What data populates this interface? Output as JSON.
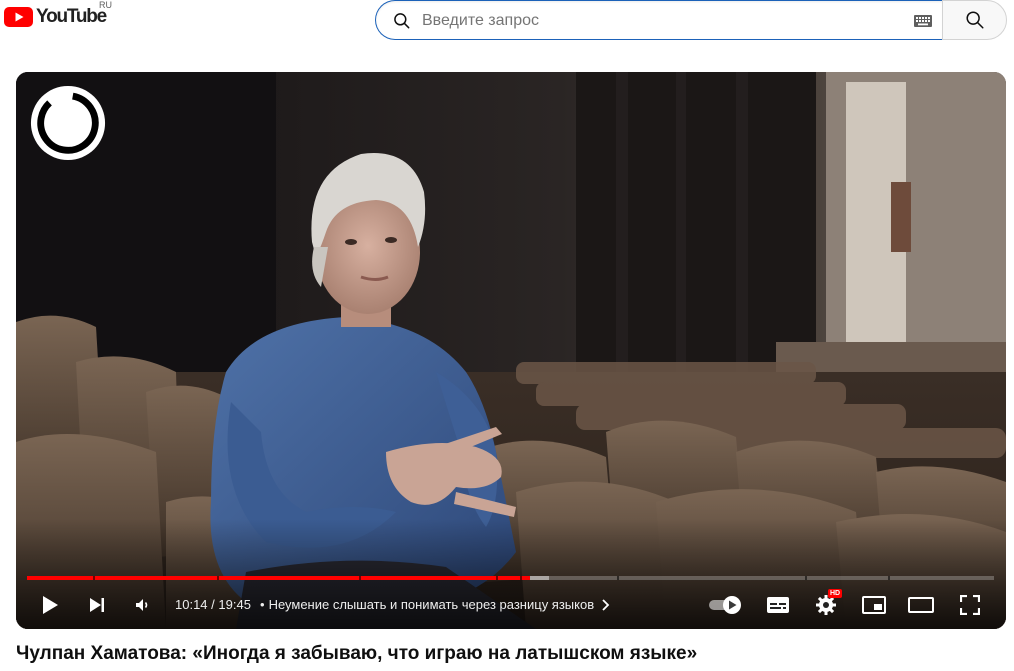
{
  "masthead": {
    "logo_text": "YouTube",
    "country_code": "RU",
    "logo_color": "#ff0000",
    "search": {
      "placeholder": "Введите запрос",
      "value": "",
      "search_icon": "search-icon",
      "keyboard_icon": "keyboard-icon"
    }
  },
  "player": {
    "watermark_icon": "channel-logo-ring",
    "progress": {
      "played_fraction": 0.52,
      "loaded_fraction": 0.54,
      "chapter_marks": [
        0.068,
        0.196,
        0.343,
        0.485,
        0.51,
        0.61,
        0.805,
        0.89
      ],
      "played_color": "#ff0000"
    },
    "time": {
      "current": "10:14",
      "separator": " / ",
      "duration": "19:45"
    },
    "chapter": {
      "bullet": "•",
      "title": "Неумение слышать и понимать через разницу языков"
    },
    "settings_badge": "HD",
    "icons": [
      "play-icon",
      "next-icon",
      "volume-icon",
      "autoplay-toggle-icon",
      "subtitles-icon",
      "settings-icon",
      "miniplayer-icon",
      "theater-mode-icon",
      "fullscreen-icon"
    ]
  },
  "video": {
    "title": "Чулпан Хаматова: «Иногда я забываю, что играю на латышском языке»"
  }
}
